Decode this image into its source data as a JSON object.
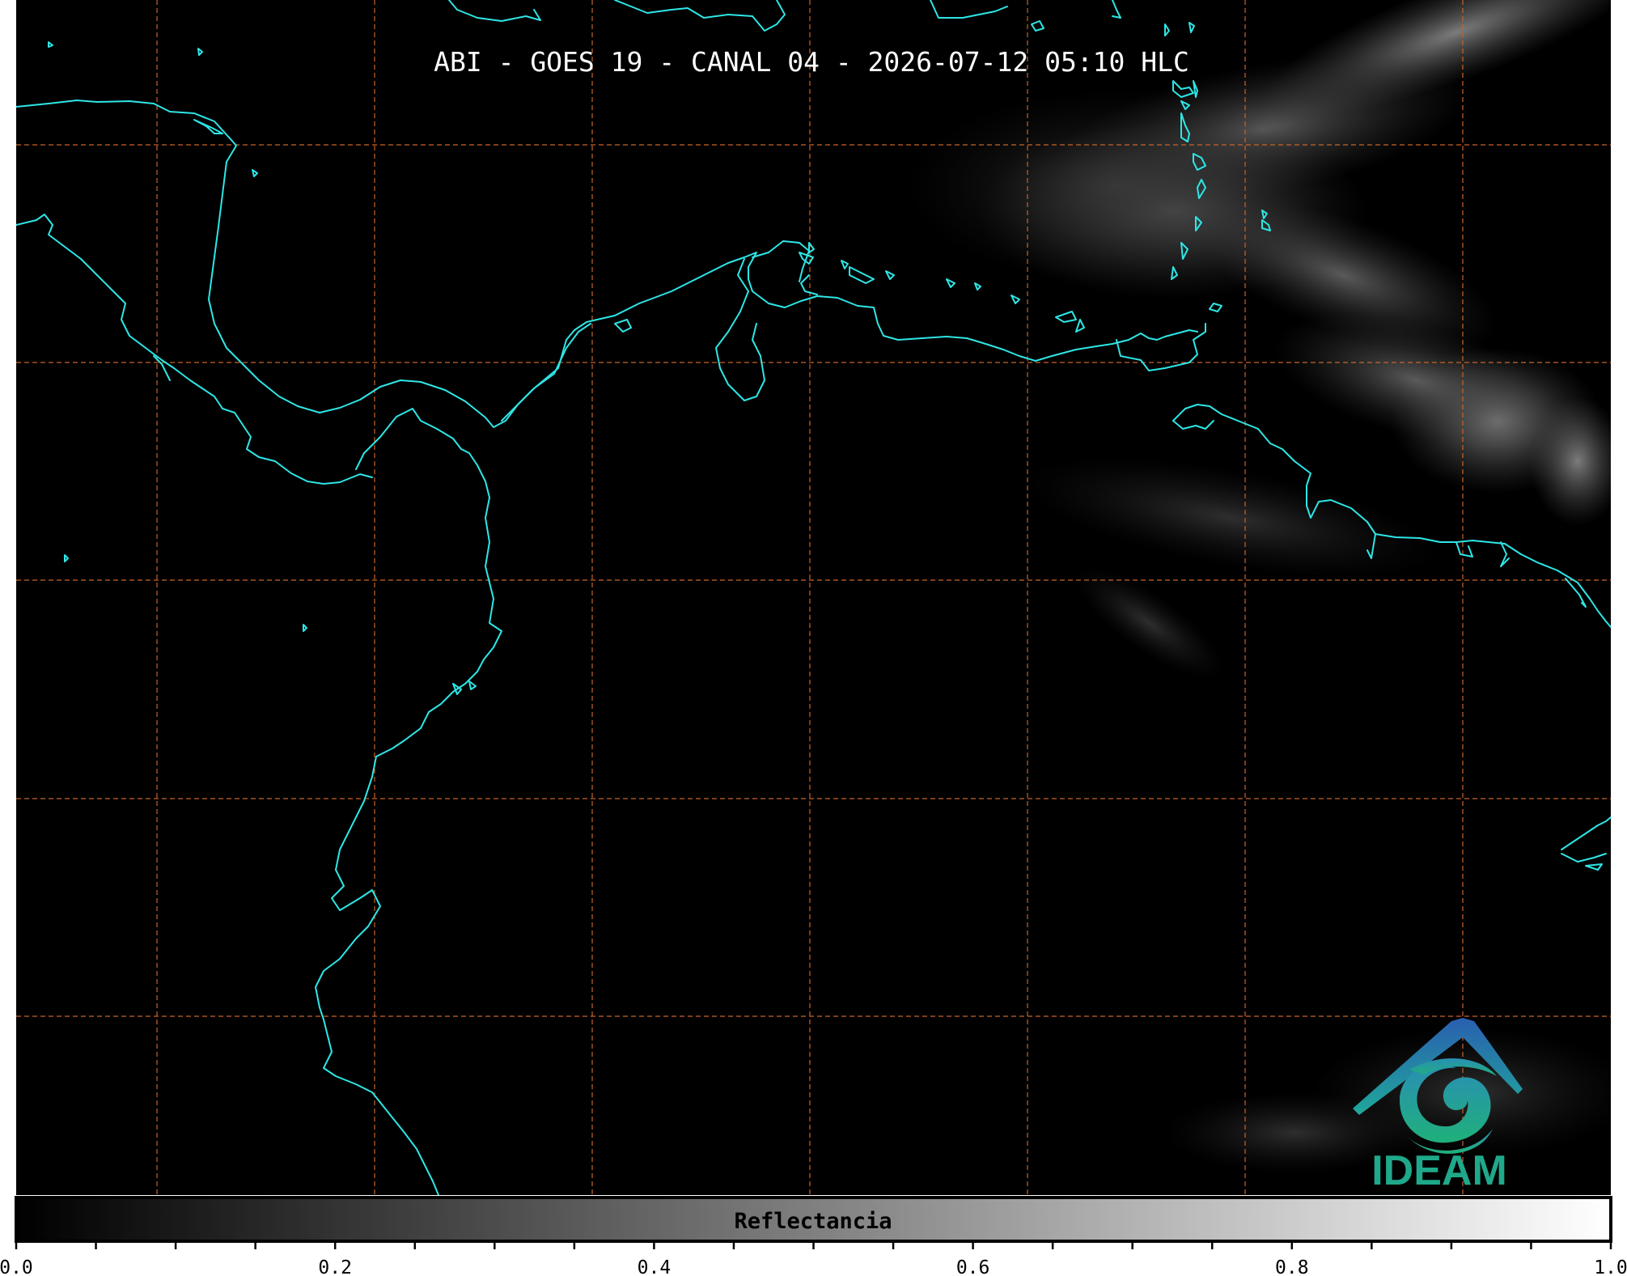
{
  "title": "ABI - GOES 19 - CANAL 04 - 2026-07-12 05:10 HLC",
  "logo": {
    "text": "IDEAM",
    "icon": "ideam-logo"
  },
  "colorbar": {
    "label": "Reflectancia",
    "ticks": [
      "0.0",
      "0.2",
      "0.4",
      "0.6",
      "0.8",
      "1.0"
    ]
  },
  "colors": {
    "background": "#000000",
    "coastline": "#2ee6e6",
    "gridline": "#c8642a",
    "title": "#ffffff",
    "logo_blue": "#2a6fb5",
    "logo_green": "#1fa88a"
  }
}
